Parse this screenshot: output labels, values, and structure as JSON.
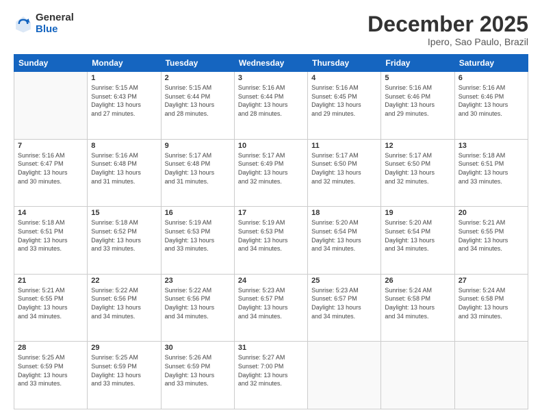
{
  "logo": {
    "general": "General",
    "blue": "Blue"
  },
  "header": {
    "month": "December 2025",
    "location": "Ipero, Sao Paulo, Brazil"
  },
  "weekdays": [
    "Sunday",
    "Monday",
    "Tuesday",
    "Wednesday",
    "Thursday",
    "Friday",
    "Saturday"
  ],
  "weeks": [
    [
      {
        "day": "",
        "info": ""
      },
      {
        "day": "1",
        "info": "Sunrise: 5:15 AM\nSunset: 6:43 PM\nDaylight: 13 hours\nand 27 minutes."
      },
      {
        "day": "2",
        "info": "Sunrise: 5:15 AM\nSunset: 6:44 PM\nDaylight: 13 hours\nand 28 minutes."
      },
      {
        "day": "3",
        "info": "Sunrise: 5:16 AM\nSunset: 6:44 PM\nDaylight: 13 hours\nand 28 minutes."
      },
      {
        "day": "4",
        "info": "Sunrise: 5:16 AM\nSunset: 6:45 PM\nDaylight: 13 hours\nand 29 minutes."
      },
      {
        "day": "5",
        "info": "Sunrise: 5:16 AM\nSunset: 6:46 PM\nDaylight: 13 hours\nand 29 minutes."
      },
      {
        "day": "6",
        "info": "Sunrise: 5:16 AM\nSunset: 6:46 PM\nDaylight: 13 hours\nand 30 minutes."
      }
    ],
    [
      {
        "day": "7",
        "info": "Sunrise: 5:16 AM\nSunset: 6:47 PM\nDaylight: 13 hours\nand 30 minutes."
      },
      {
        "day": "8",
        "info": "Sunrise: 5:16 AM\nSunset: 6:48 PM\nDaylight: 13 hours\nand 31 minutes."
      },
      {
        "day": "9",
        "info": "Sunrise: 5:17 AM\nSunset: 6:48 PM\nDaylight: 13 hours\nand 31 minutes."
      },
      {
        "day": "10",
        "info": "Sunrise: 5:17 AM\nSunset: 6:49 PM\nDaylight: 13 hours\nand 32 minutes."
      },
      {
        "day": "11",
        "info": "Sunrise: 5:17 AM\nSunset: 6:50 PM\nDaylight: 13 hours\nand 32 minutes."
      },
      {
        "day": "12",
        "info": "Sunrise: 5:17 AM\nSunset: 6:50 PM\nDaylight: 13 hours\nand 32 minutes."
      },
      {
        "day": "13",
        "info": "Sunrise: 5:18 AM\nSunset: 6:51 PM\nDaylight: 13 hours\nand 33 minutes."
      }
    ],
    [
      {
        "day": "14",
        "info": "Sunrise: 5:18 AM\nSunset: 6:51 PM\nDaylight: 13 hours\nand 33 minutes."
      },
      {
        "day": "15",
        "info": "Sunrise: 5:18 AM\nSunset: 6:52 PM\nDaylight: 13 hours\nand 33 minutes."
      },
      {
        "day": "16",
        "info": "Sunrise: 5:19 AM\nSunset: 6:53 PM\nDaylight: 13 hours\nand 33 minutes."
      },
      {
        "day": "17",
        "info": "Sunrise: 5:19 AM\nSunset: 6:53 PM\nDaylight: 13 hours\nand 34 minutes."
      },
      {
        "day": "18",
        "info": "Sunrise: 5:20 AM\nSunset: 6:54 PM\nDaylight: 13 hours\nand 34 minutes."
      },
      {
        "day": "19",
        "info": "Sunrise: 5:20 AM\nSunset: 6:54 PM\nDaylight: 13 hours\nand 34 minutes."
      },
      {
        "day": "20",
        "info": "Sunrise: 5:21 AM\nSunset: 6:55 PM\nDaylight: 13 hours\nand 34 minutes."
      }
    ],
    [
      {
        "day": "21",
        "info": "Sunrise: 5:21 AM\nSunset: 6:55 PM\nDaylight: 13 hours\nand 34 minutes."
      },
      {
        "day": "22",
        "info": "Sunrise: 5:22 AM\nSunset: 6:56 PM\nDaylight: 13 hours\nand 34 minutes."
      },
      {
        "day": "23",
        "info": "Sunrise: 5:22 AM\nSunset: 6:56 PM\nDaylight: 13 hours\nand 34 minutes."
      },
      {
        "day": "24",
        "info": "Sunrise: 5:23 AM\nSunset: 6:57 PM\nDaylight: 13 hours\nand 34 minutes."
      },
      {
        "day": "25",
        "info": "Sunrise: 5:23 AM\nSunset: 6:57 PM\nDaylight: 13 hours\nand 34 minutes."
      },
      {
        "day": "26",
        "info": "Sunrise: 5:24 AM\nSunset: 6:58 PM\nDaylight: 13 hours\nand 34 minutes."
      },
      {
        "day": "27",
        "info": "Sunrise: 5:24 AM\nSunset: 6:58 PM\nDaylight: 13 hours\nand 33 minutes."
      }
    ],
    [
      {
        "day": "28",
        "info": "Sunrise: 5:25 AM\nSunset: 6:59 PM\nDaylight: 13 hours\nand 33 minutes."
      },
      {
        "day": "29",
        "info": "Sunrise: 5:25 AM\nSunset: 6:59 PM\nDaylight: 13 hours\nand 33 minutes."
      },
      {
        "day": "30",
        "info": "Sunrise: 5:26 AM\nSunset: 6:59 PM\nDaylight: 13 hours\nand 33 minutes."
      },
      {
        "day": "31",
        "info": "Sunrise: 5:27 AM\nSunset: 7:00 PM\nDaylight: 13 hours\nand 32 minutes."
      },
      {
        "day": "",
        "info": ""
      },
      {
        "day": "",
        "info": ""
      },
      {
        "day": "",
        "info": ""
      }
    ]
  ]
}
